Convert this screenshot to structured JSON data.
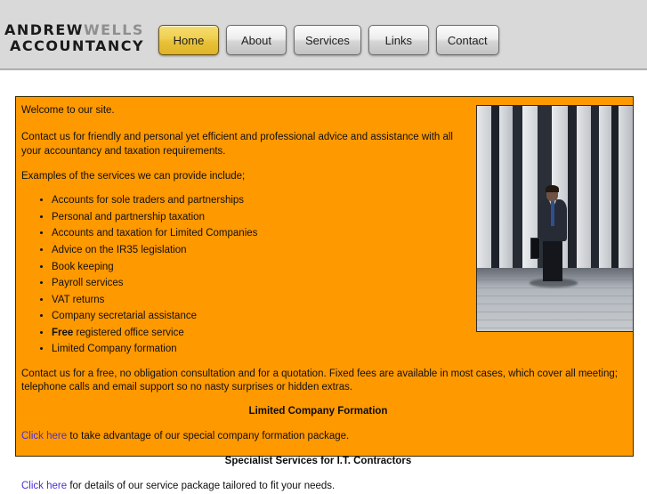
{
  "header": {
    "logo": {
      "line1_dark": "ANDREW",
      "line1_gray": "WELLS",
      "line2": "ACCOUNTANCY"
    },
    "nav": [
      {
        "label": "Home",
        "active": true
      },
      {
        "label": "About",
        "active": false
      },
      {
        "label": "Services",
        "active": false
      },
      {
        "label": "Links",
        "active": false
      },
      {
        "label": "Contact",
        "active": false
      }
    ]
  },
  "main": {
    "welcome": "Welcome to our site.",
    "intro": "Contact us for friendly and personal yet efficient and professional advice and assistance with all your accountancy and taxation requirements.",
    "examples_lead": "Examples of the services we can provide include;",
    "services": [
      {
        "text": "Accounts for sole traders and partnerships",
        "bold_prefix": ""
      },
      {
        "text": "Personal and partnership taxation",
        "bold_prefix": ""
      },
      {
        "text": "Accounts and taxation for Limited Companies",
        "bold_prefix": ""
      },
      {
        "text": "Advice on the IR35 legislation",
        "bold_prefix": ""
      },
      {
        "text": "Book keeping",
        "bold_prefix": ""
      },
      {
        "text": "Payroll services",
        "bold_prefix": ""
      },
      {
        "text": "VAT returns",
        "bold_prefix": ""
      },
      {
        "text": "Company secretarial assistance",
        "bold_prefix": ""
      },
      {
        "text": " registered office service",
        "bold_prefix": "Free"
      },
      {
        "text": "Limited Company formation",
        "bold_prefix": ""
      }
    ],
    "contact_para": "Contact us for a free, no obligation consultation and for a quotation. Fixed fees are available in most cases, which cover all meeting; telephone calls and email support so no nasty surprises or hidden extras.",
    "heading_formation": "Limited Company Formation",
    "link1_text": "Click here",
    "link1_rest": " to take advantage of our special company formation package.",
    "heading_it": "Specialist Services for I.T. Contractors",
    "link2_text": "Click here",
    "link2_rest": " for details of our service package tailored to fit your needs.",
    "photo_alt": "businessman walking past concrete columns"
  },
  "colors": {
    "panel_orange": "#ff9900",
    "active_button_gold": "#e8c238",
    "link_blue": "#4b2fd6",
    "header_gray": "#d9d9d9"
  }
}
